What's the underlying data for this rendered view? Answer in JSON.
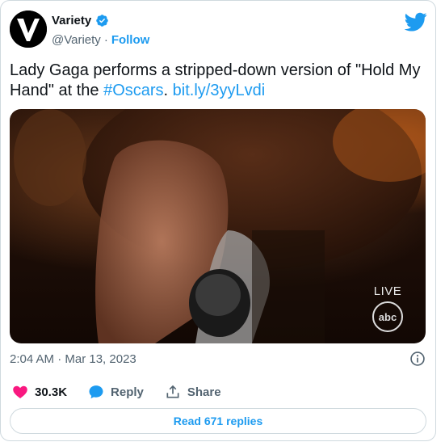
{
  "account": {
    "name": "Variety",
    "handle": "@Variety",
    "separator": "·",
    "follow_label": "Follow"
  },
  "tweet": {
    "text_prefix": "Lady Gaga performs a stripped-down version of \"Hold My Hand\" at the ",
    "hashtag": "#Oscars",
    "text_mid": ". ",
    "link": "bit.ly/3yyLvdi"
  },
  "media": {
    "live_label": "LIVE",
    "network_logo_text": "abc"
  },
  "meta": {
    "timestamp": "2:04 AM · Mar 13, 2023"
  },
  "actions": {
    "likes_count": "30.3K",
    "reply_label": "Reply",
    "share_label": "Share"
  },
  "footer": {
    "read_replies_label": "Read 671 replies"
  },
  "icons": {
    "verified": "verified-badge-icon",
    "bird": "twitter-bird-icon",
    "info": "info-icon",
    "heart": "heart-icon",
    "reply": "reply-bubble-icon",
    "share": "share-icon"
  },
  "colors": {
    "accent": "#1d9bf0",
    "heart": "#f91880",
    "text": "#0f1419",
    "muted": "#536471",
    "border": "#cfd9de"
  }
}
